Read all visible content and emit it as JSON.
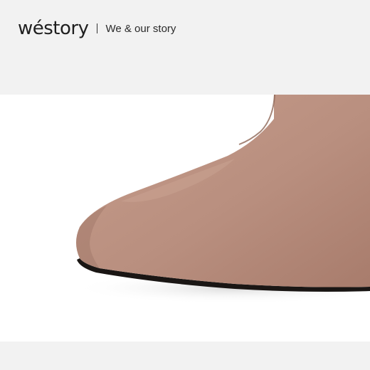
{
  "header": {
    "logo_text": "wéstory",
    "tagline": "We & our story"
  },
  "photo": {
    "subject": "boot-toe-suede",
    "colors": {
      "suede": "#b98f7f",
      "suede_shadow": "#9e7566",
      "sole": "#1a1614",
      "background": "#ffffff",
      "band": "#f2f2f2"
    }
  }
}
